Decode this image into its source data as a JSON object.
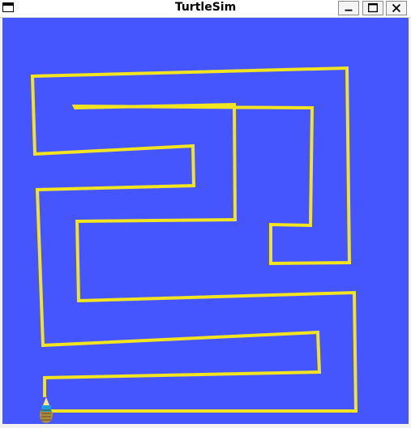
{
  "window": {
    "title": "TurtleSim"
  },
  "titlebar_buttons": [
    {
      "name": "minimize-button",
      "icon": "minimize-icon"
    },
    {
      "name": "maximize-button",
      "icon": "maximize-icon"
    },
    {
      "name": "close-button",
      "icon": "close-icon"
    }
  ],
  "canvas": {
    "background_color": "#4556ff",
    "pen_color": "#f2e41f"
  },
  "turtle": {
    "icon": "turtle-icon"
  }
}
